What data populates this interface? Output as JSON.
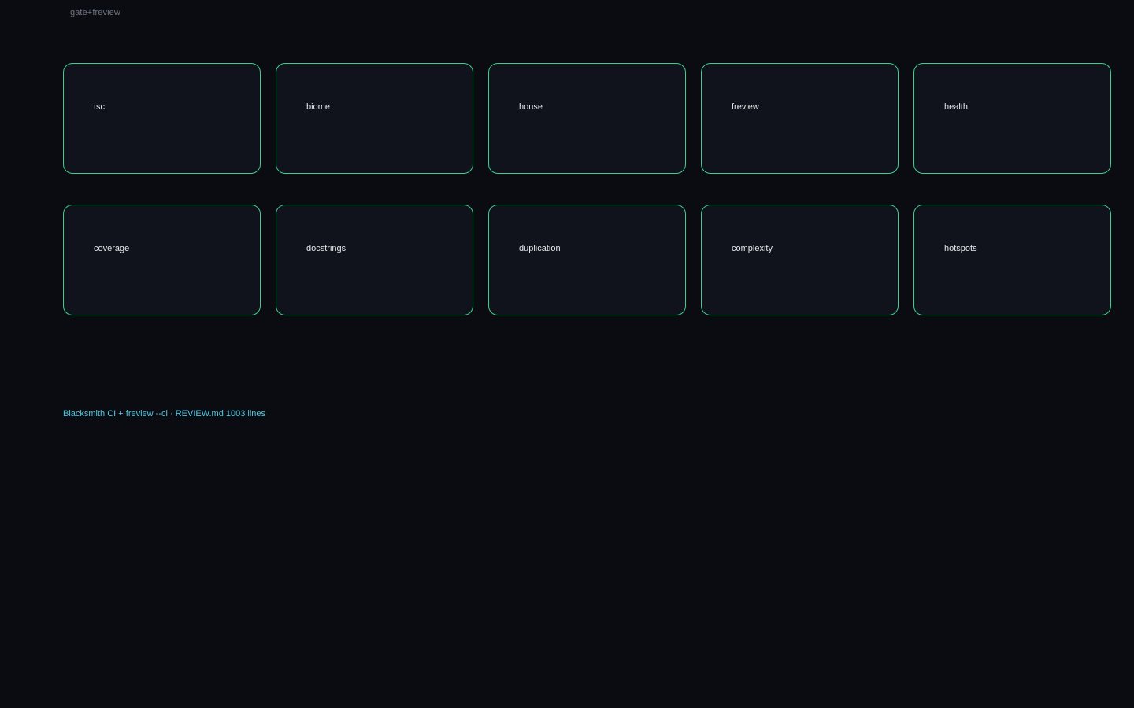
{
  "header": {
    "label": "gate+freview"
  },
  "cards": [
    {
      "label": "tsc"
    },
    {
      "label": "biome"
    },
    {
      "label": "house"
    },
    {
      "label": "freview"
    },
    {
      "label": "health"
    },
    {
      "label": "coverage"
    },
    {
      "label": "docstrings"
    },
    {
      "label": "duplication"
    },
    {
      "label": "complexity"
    },
    {
      "label": "hotspots"
    }
  ],
  "footer": {
    "note": "Blacksmith CI + freview --ci · REVIEW.md 1003 lines"
  },
  "colors": {
    "background": "#0a0c12",
    "card_background": "#10131b",
    "card_border": "#3ecf8e",
    "footer_text": "#4ec9e6"
  }
}
